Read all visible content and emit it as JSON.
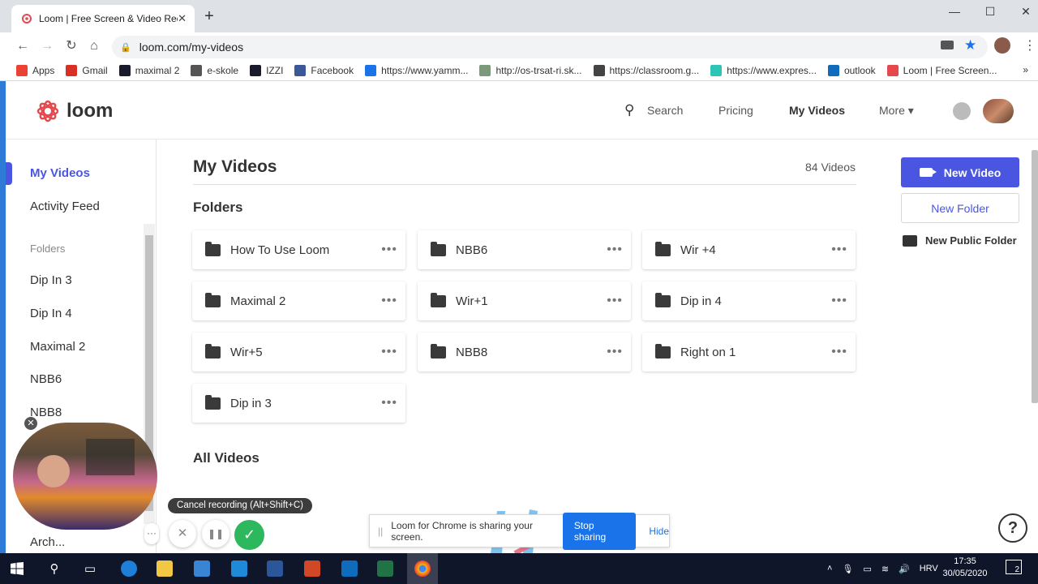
{
  "browser": {
    "tab_title": "Loom | Free Screen & Video Reco",
    "tab_close": "✕",
    "new_tab": "+",
    "window_controls": {
      "minimize": "—",
      "maximize": "☐",
      "close": "✕"
    },
    "url": "loom.com/my-videos",
    "bookmarks": [
      {
        "label": "Apps",
        "color": "#ea4335"
      },
      {
        "label": "Gmail",
        "color": "#d93025"
      },
      {
        "label": "maximal 2",
        "color": "#1a1a2e"
      },
      {
        "label": "e-skole",
        "color": "#555555"
      },
      {
        "label": "IZZI",
        "color": "#1a1a2e"
      },
      {
        "label": "Facebook",
        "color": "#3b5998"
      },
      {
        "label": "https://www.yamm...",
        "color": "#1a73e8"
      },
      {
        "label": "http://os-trsat-ri.sk...",
        "color": "#7a9a7a"
      },
      {
        "label": "https://classroom.g...",
        "color": "#444444"
      },
      {
        "label": "https://www.expres...",
        "color": "#2ec4b6"
      },
      {
        "label": "outlook",
        "color": "#0f6cbd"
      },
      {
        "label": "Loom | Free Screen...",
        "color": "#e5484d"
      }
    ],
    "more_bookmarks": "»"
  },
  "header": {
    "logo_text": "loom",
    "search_label": "Search",
    "pricing_label": "Pricing",
    "myvideos_label": "My Videos",
    "more_label": "More ▾"
  },
  "sidebar": {
    "items": [
      "My Videos",
      "Activity Feed"
    ],
    "folders_heading": "Folders",
    "folders": [
      "Dip In 3",
      "Dip In 4",
      "Maximal 2",
      "NBB6",
      "NBB8"
    ],
    "archive": "Arch..."
  },
  "main": {
    "title": "My Videos",
    "video_count": "84 Videos",
    "folders_heading": "Folders",
    "folders": [
      "How To Use Loom",
      "NBB6",
      "Wir +4",
      "Maximal 2",
      "Wir+1",
      "Dip in 4",
      "Wir+5",
      "NBB8",
      "Right on 1",
      "Dip in 3"
    ],
    "menu_glyph": "•••",
    "all_videos_heading": "All Videos"
  },
  "actions": {
    "new_video": "New Video",
    "new_folder": "New Folder",
    "new_public_folder": "New Public Folder"
  },
  "recorder": {
    "tooltip": "Cancel recording (Alt+Shift+C)",
    "more_glyph": "···",
    "cancel_glyph": "✕",
    "pause_glyph": "❚❚",
    "done_glyph": "✓",
    "close_glyph": "✕"
  },
  "share_bar": {
    "grip": "||",
    "message": "Loom for Chrome is sharing your screen.",
    "stop": "Stop sharing",
    "hide": "Hide"
  },
  "help": "?",
  "taskbar": {
    "language": "HRV",
    "time": "17:35",
    "date": "30/05/2020",
    "notifications": "2"
  },
  "colors": {
    "brand": "#4a56e2",
    "success": "#2db85d",
    "accent": "#e5484d"
  }
}
